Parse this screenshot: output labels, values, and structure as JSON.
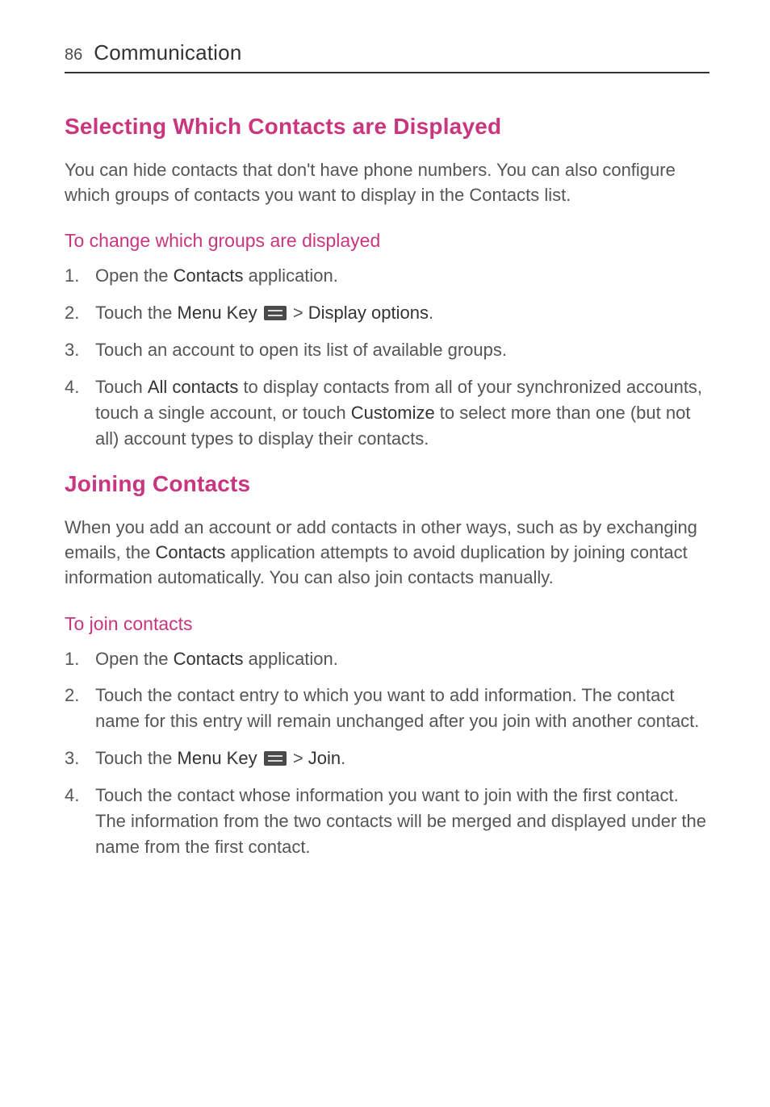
{
  "header": {
    "page_number": "86",
    "chapter": "Communication"
  },
  "section1": {
    "heading": "Selecting Which Contacts are Displayed",
    "intro": "You can hide contacts that don't have phone numbers. You can also configure which groups of contacts you want to display in the Contacts list.",
    "sub_heading": "To change which groups are displayed",
    "step1_a": "Open the ",
    "step1_b": "Contacts",
    "step1_c": " application.",
    "step2_a": "Touch the ",
    "step2_b": "Menu Key",
    "step2_c": " > ",
    "step2_d": "Display options",
    "step2_e": ".",
    "step3": "Touch an account to open its list of available groups.",
    "step4_a": "Touch ",
    "step4_b": "All contacts",
    "step4_c": " to display contacts from all of your synchronized accounts, touch a single account, or touch ",
    "step4_d": "Customize",
    "step4_e": " to select more than one (but not all) account types to display their contacts."
  },
  "section2": {
    "heading": "Joining Contacts",
    "intro_a": "When you add an account or add contacts in other ways, such as by exchanging emails, the ",
    "intro_b": "Contacts",
    "intro_c": " application attempts to avoid duplication by joining contact information automatically. You can also join contacts manually.",
    "sub_heading": "To join contacts",
    "step1_a": "Open the ",
    "step1_b": "Contacts",
    "step1_c": " application.",
    "step2": "Touch the contact entry to which you want to add information. The contact name for this entry will remain unchanged after you join with another contact.",
    "step3_a": "Touch the ",
    "step3_b": "Menu Key",
    "step3_c": " > ",
    "step3_d": "Join",
    "step3_e": ".",
    "step4": "Touch the contact whose information you want to join with the first contact. The information from the two contacts will be merged and displayed under the name from the first contact."
  }
}
